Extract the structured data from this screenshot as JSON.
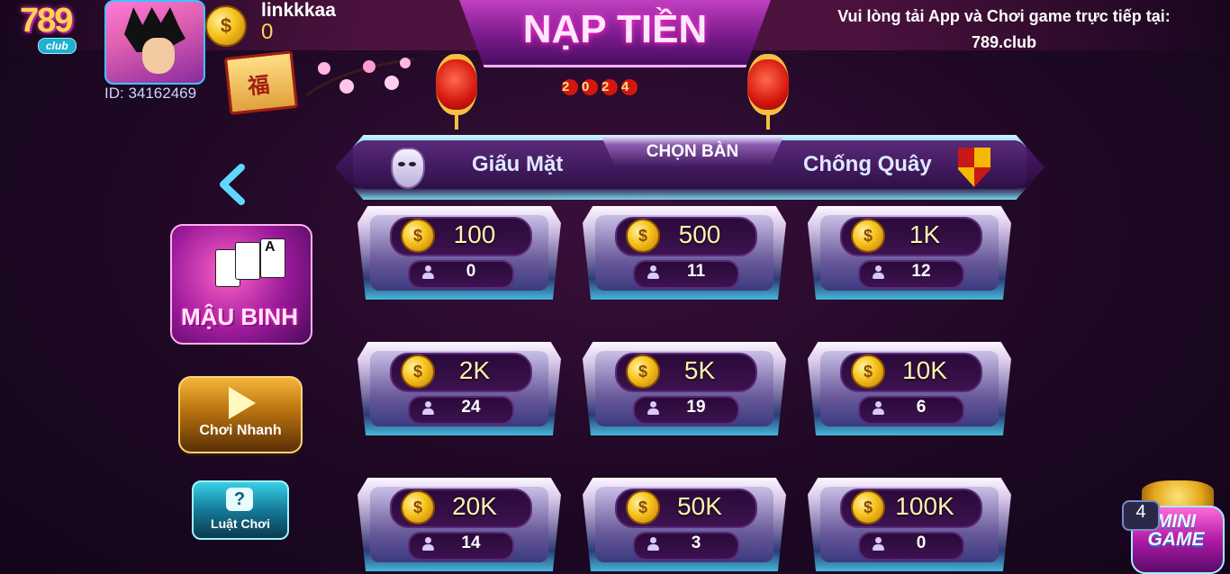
{
  "header": {
    "logo_number": "789",
    "logo_club": "club",
    "user_id": "ID: 34162469",
    "username": "linkkkaa",
    "balance": "0",
    "coin_symbol": "$",
    "banner_title": "NẠP TIỀN",
    "year_digits": [
      "2",
      "0",
      "2",
      "4"
    ],
    "notice_line1": "Vui lòng tải App và Chơi game trực tiếp tại:",
    "notice_line2": "789.club"
  },
  "left_panel": {
    "game_title": "MẬU BINH",
    "card_ace": "A",
    "quick_play_label": "Chơi Nhanh",
    "rules_label": "Luật Chơi",
    "rules_glyph": "?"
  },
  "tabs": {
    "left": "Giấu Mặt",
    "center": "CHỌN BÀN",
    "right": "Chống Quây"
  },
  "tables": [
    {
      "bet": "100",
      "players": "0"
    },
    {
      "bet": "500",
      "players": "11"
    },
    {
      "bet": "1K",
      "players": "12"
    },
    {
      "bet": "2K",
      "players": "24"
    },
    {
      "bet": "5K",
      "players": "19"
    },
    {
      "bet": "10K",
      "players": "6"
    },
    {
      "bet": "20K",
      "players": "14"
    },
    {
      "bet": "50K",
      "players": "3"
    },
    {
      "bet": "100K",
      "players": "0"
    }
  ],
  "minigame": {
    "badge": "4",
    "line1": "MINI",
    "line2": "GAME"
  },
  "icons": {
    "coin": "coin-icon",
    "person": "person-icon",
    "mask": "mask-icon",
    "shield": "shield-icon",
    "back": "chevron-left-icon",
    "play": "play-icon"
  },
  "colors": {
    "accent_gold": "#ffd45a",
    "accent_cyan": "#3fc3ff",
    "background": "#1e0824"
  }
}
